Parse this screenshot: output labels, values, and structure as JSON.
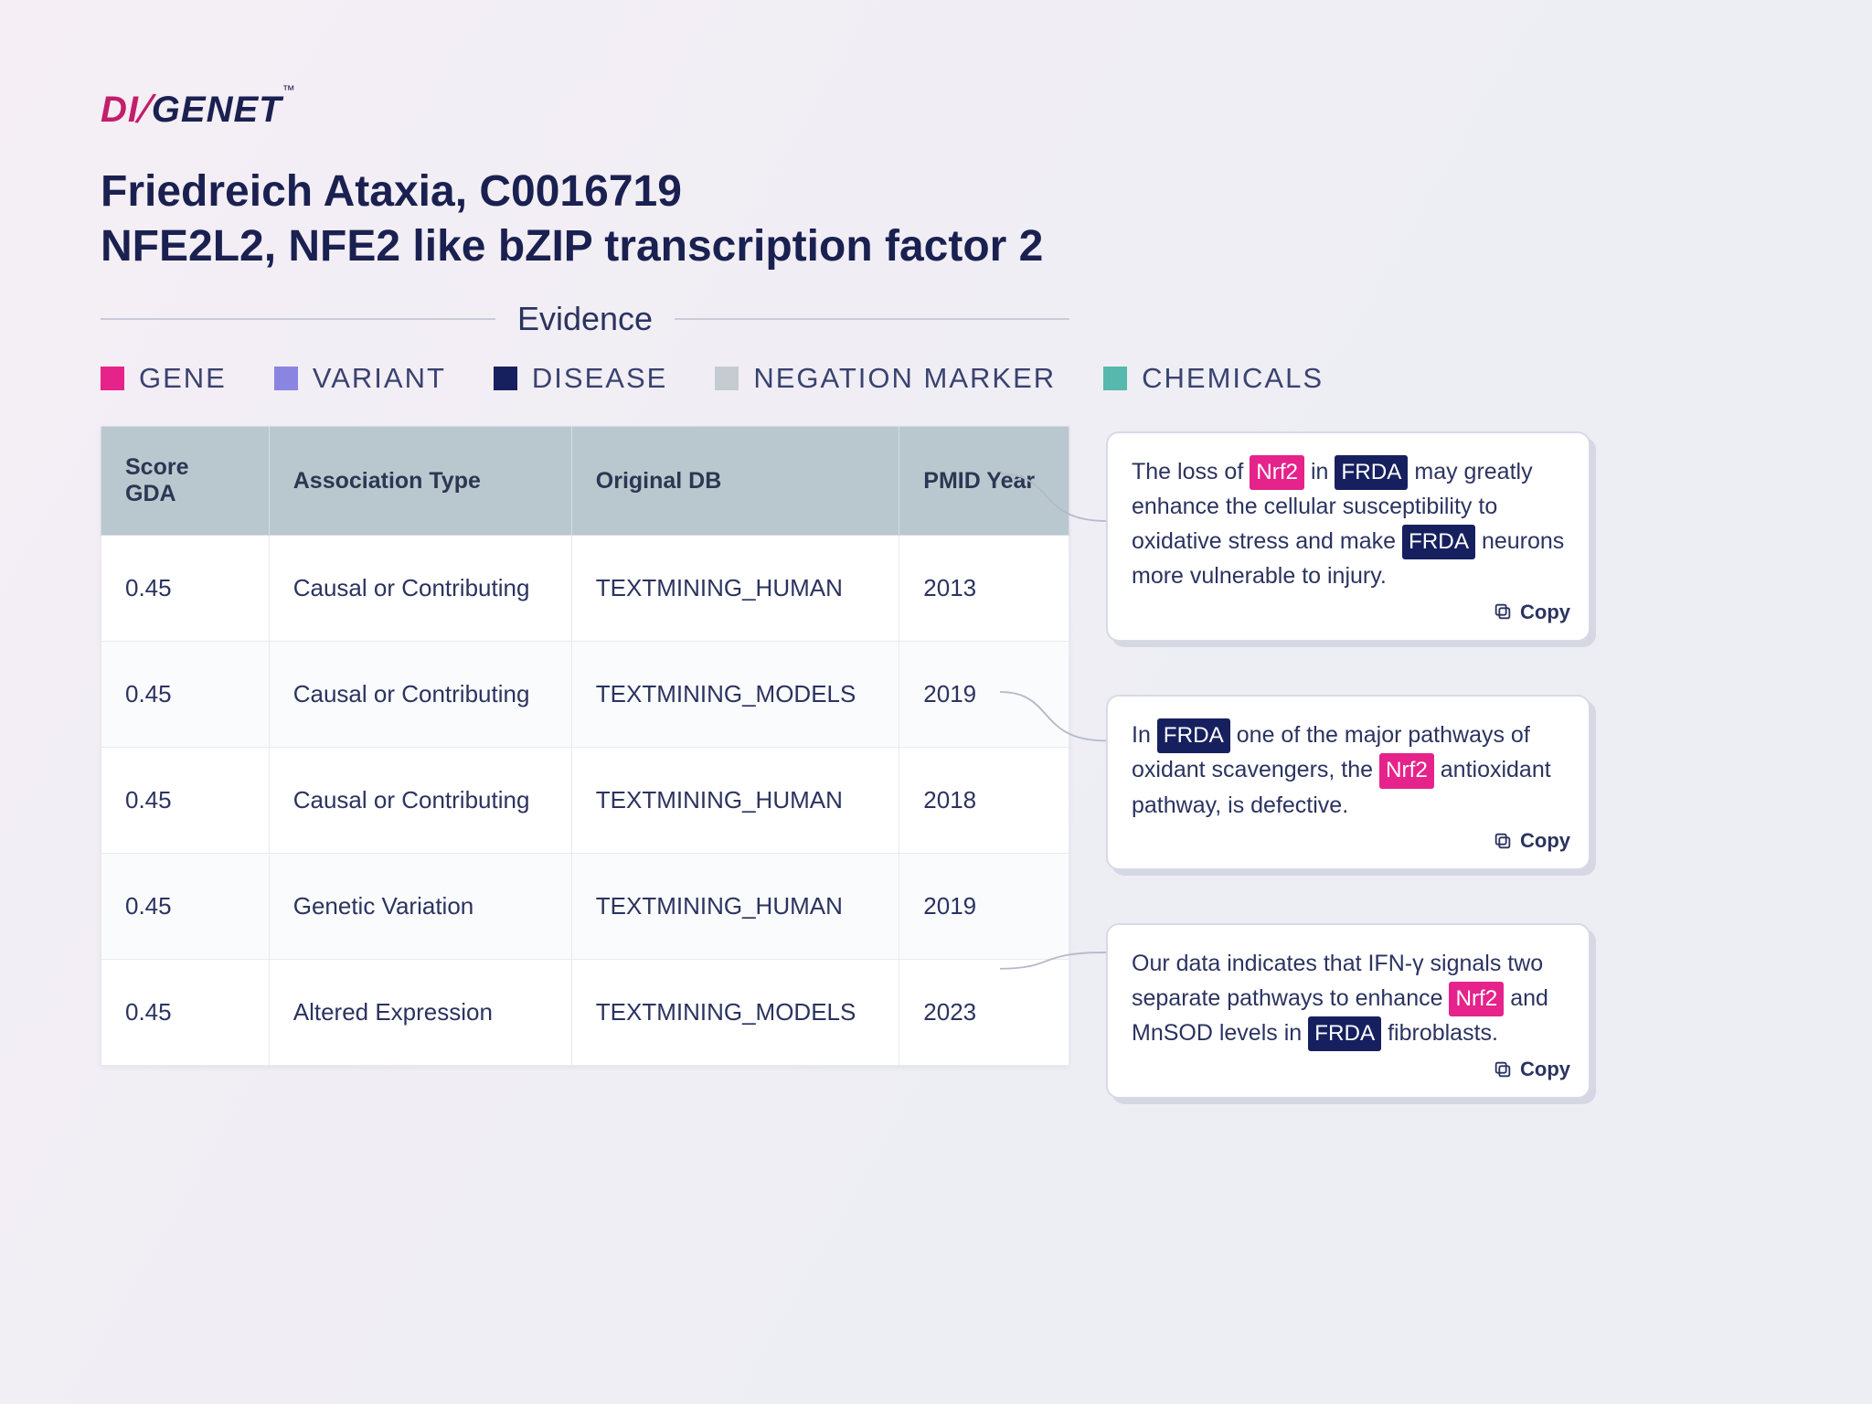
{
  "logo": {
    "di": "DI",
    "genet": "GENET"
  },
  "title_line1": "Friedreich Ataxia, C0016719",
  "title_line2": "NFE2L2, NFE2 like bZIP transcription factor 2",
  "evidence_label": "Evidence",
  "legend": [
    {
      "label": "GENE",
      "color": "#e6228b"
    },
    {
      "label": "VARIANT",
      "color": "#8a85e0"
    },
    {
      "label": "DISEASE",
      "color": "#17205f"
    },
    {
      "label": "NEGATION MARKER",
      "color": "#c6cbd2"
    },
    {
      "label": "CHEMICALS",
      "color": "#57b8ad"
    }
  ],
  "table": {
    "headers": {
      "score": "Score GDA",
      "assoc": "Association Type",
      "db": "Original DB",
      "year": "PMID Year"
    },
    "rows": [
      {
        "score": "0.45",
        "assoc": "Causal or Contributing",
        "db": "TEXTMINING_HUMAN",
        "year": "2013"
      },
      {
        "score": "0.45",
        "assoc": "Causal or Contributing",
        "db": "TEXTMINING_MODELS",
        "year": "2019"
      },
      {
        "score": "0.45",
        "assoc": "Causal or Contributing",
        "db": "TEXTMINING_HUMAN",
        "year": "2018"
      },
      {
        "score": "0.45",
        "assoc": "Genetic Variation",
        "db": "TEXTMINING_HUMAN",
        "year": "2019"
      },
      {
        "score": "0.45",
        "assoc": "Altered Expression",
        "db": "TEXTMINING_MODELS",
        "year": "2023"
      }
    ]
  },
  "cards": [
    {
      "segments": [
        {
          "t": "The loss of "
        },
        {
          "t": "Nrf2",
          "tag": "gene"
        },
        {
          "t": " in "
        },
        {
          "t": "FRDA",
          "tag": "disease"
        },
        {
          "t": " may greatly enhance the cellular susceptibility to oxidative stress and make "
        },
        {
          "t": "FRDA",
          "tag": "disease"
        },
        {
          "t": " neurons more vulnerable to injury."
        }
      ]
    },
    {
      "segments": [
        {
          "t": "In "
        },
        {
          "t": "FRDA",
          "tag": "disease"
        },
        {
          "t": " one of the major pathways of oxidant scavengers, the "
        },
        {
          "t": "Nrf2",
          "tag": "gene"
        },
        {
          "t": " antioxidant pathway, is defective."
        }
      ]
    },
    {
      "segments": [
        {
          "t": "Our data indicates that IFN-γ signals two separate pathways to enhance "
        },
        {
          "t": "Nrf2",
          "tag": "gene"
        },
        {
          "t": " and MnSOD levels in "
        },
        {
          "t": "FRDA",
          "tag": "disease"
        },
        {
          "t": " fibroblasts."
        }
      ]
    }
  ],
  "copy_label": "Copy"
}
